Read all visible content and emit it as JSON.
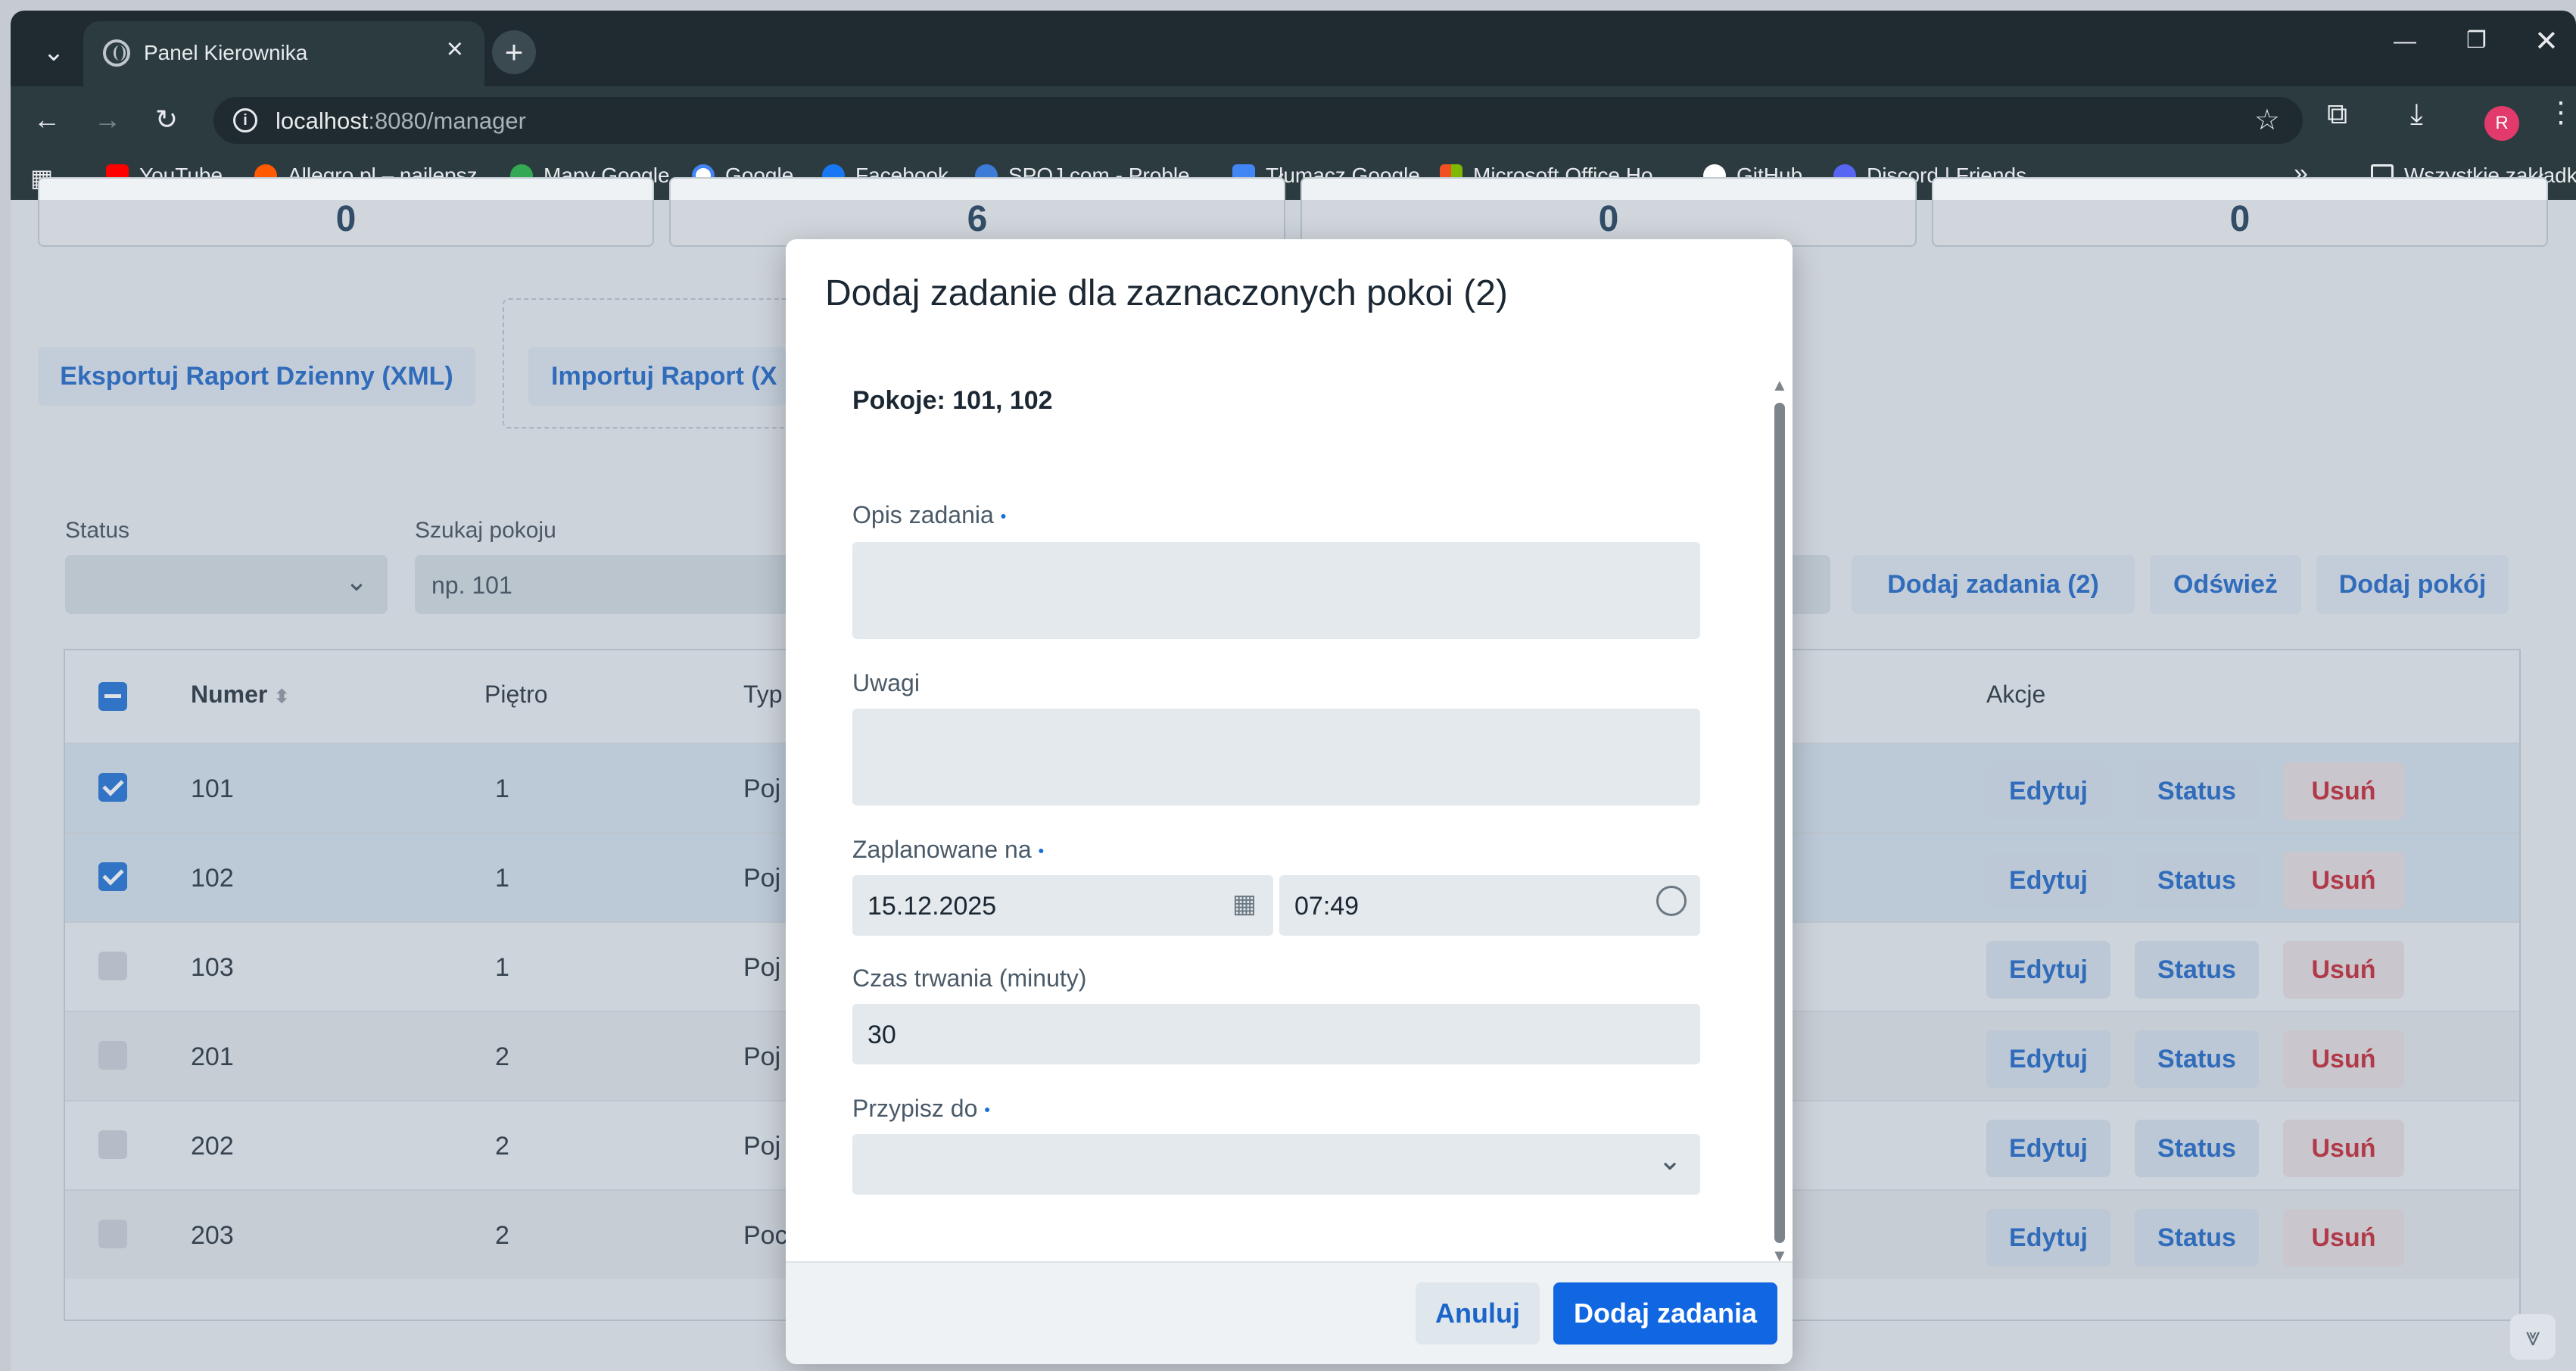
{
  "browser": {
    "tab_title": "Panel Kierownika",
    "url_host": "localhost",
    "url_path": ":8080/manager",
    "profile_initial": "R",
    "bookmarks": [
      {
        "label": "YouTube",
        "color": "#ff0000"
      },
      {
        "label": "Allegro.pl – najlepsz...",
        "color": "#ff5a00"
      },
      {
        "label": "Mapy Google",
        "color": "#34a853"
      },
      {
        "label": "Google",
        "color": "#4285f4"
      },
      {
        "label": "Facebook",
        "color": "#1877f2"
      },
      {
        "label": "SPOJ.com - Proble...",
        "color": "#3c7bd6"
      },
      {
        "label": "Tłumacz Google",
        "color": "#4285f4"
      },
      {
        "label": "Microsoft Office Ho...",
        "color": "#f25022"
      },
      {
        "label": "GitHub",
        "color": "#ffffff"
      },
      {
        "label": "Discord | Friends",
        "color": "#5865f2"
      }
    ],
    "all_bookmarks": "Wszystkie zakładki"
  },
  "stats": [
    "0",
    "6",
    "0",
    "0"
  ],
  "toolbar": {
    "export_label": "Eksportuj Raport Dzienny (XML)",
    "import_label": "Importuj Raport (X"
  },
  "filters": {
    "status_label": "Status",
    "search_label": "Szukaj pokoju",
    "search_placeholder": "np. 101",
    "add_tasks_label": "Dodaj zadania (2)",
    "refresh_label": "Odśwież",
    "add_room_label": "Dodaj pokój"
  },
  "table": {
    "headers": {
      "number": "Numer",
      "floor": "Piętro",
      "type": "Typ",
      "actions": "Akcje"
    },
    "rows": [
      {
        "number": "101",
        "floor": "1",
        "type": "Poj",
        "selected": true
      },
      {
        "number": "102",
        "floor": "1",
        "type": "Poj",
        "selected": true
      },
      {
        "number": "103",
        "floor": "1",
        "type": "Poj",
        "selected": false
      },
      {
        "number": "201",
        "floor": "2",
        "type": "Poj",
        "selected": false
      },
      {
        "number": "202",
        "floor": "2",
        "type": "Poj",
        "selected": false
      },
      {
        "number": "203",
        "floor": "2",
        "type": "Poc",
        "selected": false
      }
    ],
    "edit_label": "Edytuj",
    "status_label": "Status",
    "delete_label": "Usuń"
  },
  "modal": {
    "title": "Dodaj zadanie dla zaznaczonych pokoi (2)",
    "rooms": "Pokoje: 101, 102",
    "description_label": "Opis zadania",
    "notes_label": "Uwagi",
    "scheduled_label": "Zaplanowane na",
    "date_value": "15.12.2025",
    "time_value": "07:49",
    "duration_label": "Czas trwania (minuty)",
    "duration_value": "30",
    "assign_label": "Przypisz do",
    "required_marker": "•",
    "cancel_label": "Anuluj",
    "submit_label": "Dodaj zadania"
  }
}
